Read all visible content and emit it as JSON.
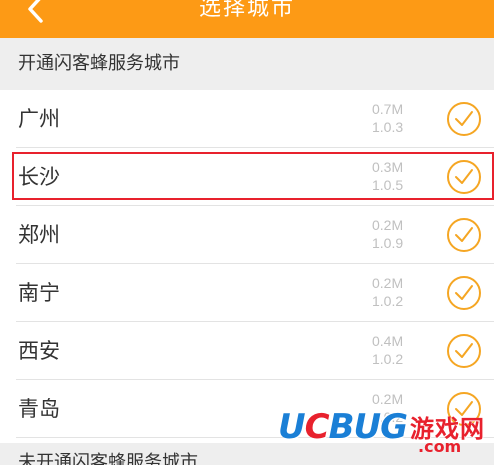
{
  "header": {
    "title": "选择城市",
    "back_icon": "chevron-left-icon",
    "background_color": "#fd9a15"
  },
  "sections": {
    "served_title": "开通闪客蜂服务城市",
    "unserved_title": "未开通闪客蜂服务城市"
  },
  "cities": [
    {
      "name": "广州",
      "size": "0.7M",
      "version": "1.0.3",
      "selected": false
    },
    {
      "name": "长沙",
      "size": "0.3M",
      "version": "1.0.5",
      "selected": false
    },
    {
      "name": "郑州",
      "size": "0.2M",
      "version": "1.0.9",
      "selected": false
    },
    {
      "name": "南宁",
      "size": "0.2M",
      "version": "1.0.2",
      "selected": false
    },
    {
      "name": "西安",
      "size": "0.4M",
      "version": "1.0.2",
      "selected": false
    },
    {
      "name": "青岛",
      "size": "0.2M",
      "version": "1.0.2",
      "selected": false
    }
  ],
  "check_icon": "check-circle-icon",
  "check_color": "#f5a623",
  "highlight_color": "#e8212d",
  "watermark": {
    "brand_u": "U",
    "brand_c": "C",
    "brand_rest": "BUG",
    "cn_text": "游戏网",
    "com_text": ".com"
  }
}
